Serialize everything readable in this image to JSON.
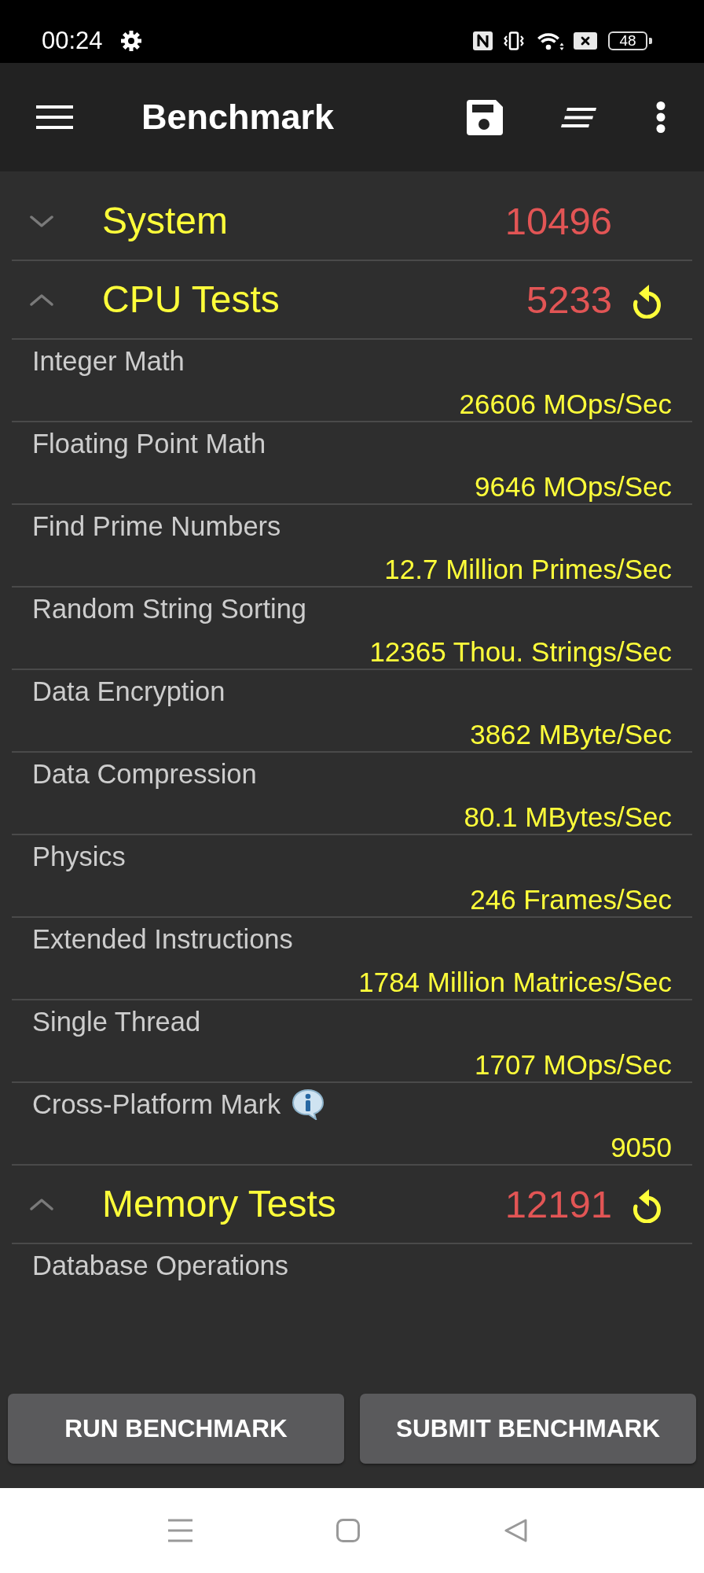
{
  "status_bar": {
    "time": "00:24",
    "battery": "48"
  },
  "app_bar": {
    "title": "Benchmark"
  },
  "sections": [
    {
      "title": "System",
      "score": "10496",
      "expanded": false,
      "rerun": false
    },
    {
      "title": "CPU Tests",
      "score": "5233",
      "expanded": true,
      "rerun": true,
      "tests": [
        {
          "name": "Integer Math",
          "value": "26606 MOps/Sec",
          "info": false
        },
        {
          "name": "Floating Point Math",
          "value": "9646 MOps/Sec",
          "info": false
        },
        {
          "name": "Find Prime Numbers",
          "value": "12.7 Million Primes/Sec",
          "info": false
        },
        {
          "name": "Random String Sorting",
          "value": "12365 Thou. Strings/Sec",
          "info": false
        },
        {
          "name": "Data Encryption",
          "value": "3862 MByte/Sec",
          "info": false
        },
        {
          "name": "Data Compression",
          "value": "80.1 MBytes/Sec",
          "info": false
        },
        {
          "name": "Physics",
          "value": "246 Frames/Sec",
          "info": false
        },
        {
          "name": "Extended Instructions",
          "value": "1784 Million Matrices/Sec",
          "info": false
        },
        {
          "name": "Single Thread",
          "value": "1707 MOps/Sec",
          "info": false
        },
        {
          "name": "Cross-Platform Mark",
          "value": "9050",
          "info": true
        }
      ]
    },
    {
      "title": "Memory Tests",
      "score": "12191",
      "expanded": true,
      "rerun": true,
      "tests": [
        {
          "name": "Database Operations",
          "info": false
        }
      ]
    }
  ],
  "buttons": [
    "RUN BENCHMARK",
    "SUBMIT BENCHMARK"
  ]
}
